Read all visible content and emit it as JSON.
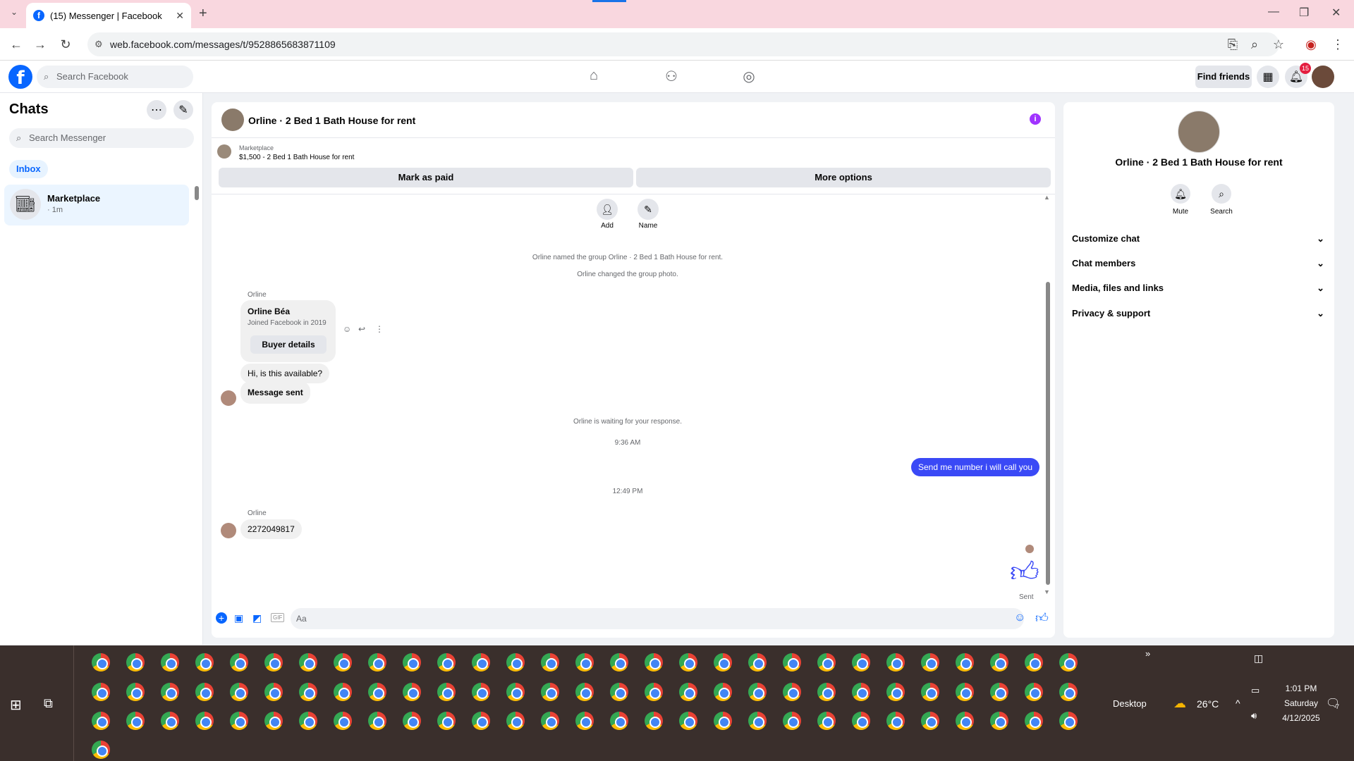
{
  "browser": {
    "tab_title": "(15) Messenger | Facebook",
    "url": "web.facebook.com/messages/t/9528865683871109"
  },
  "fb_header": {
    "search_placeholder": "Search Facebook",
    "find_friends": "Find friends",
    "notification_count": "15"
  },
  "sidebar": {
    "title": "Chats",
    "search_placeholder": "Search Messenger",
    "filter_inbox": "Inbox",
    "chats": [
      {
        "name": "Marketplace",
        "time": "· 1m"
      }
    ]
  },
  "chat": {
    "title": "Orline · 2 Bed 1 Bath House for rent",
    "listing_source": "Marketplace",
    "listing_summary": "$1,500 - 2 Bed 1 Bath House for rent",
    "mark_paid": "Mark as paid",
    "more_options": "More options",
    "add_label": "Add",
    "name_label": "Name",
    "sys_named": "Orline named the group Orline · 2 Bed 1 Bath House for rent.",
    "sys_photo": "Orline changed the group photo.",
    "sender_label_1": "Orline",
    "buyer_name": "Orline Béa",
    "buyer_joined": "Joined Facebook in 2019",
    "buyer_details": "Buyer details",
    "msg_available": "Hi, is this available?",
    "msg_sent_card": "Message sent",
    "sys_waiting": "Orline is waiting for your response.",
    "time_1": "9:36 AM",
    "my_msg": "Send me number i will call you",
    "time_2": "12:49 PM",
    "sender_label_2": "Orline",
    "msg_number": "2272049817",
    "status_sent": "Sent",
    "composer_placeholder": "Aa"
  },
  "info_panel": {
    "title": "Orline · 2 Bed 1 Bath House for rent",
    "mute": "Mute",
    "search": "Search",
    "sections": [
      "Customize chat",
      "Chat members",
      "Media, files and links",
      "Privacy & support"
    ]
  },
  "taskbar": {
    "desktop_label": "Desktop",
    "weather": "26°C",
    "time": "1:01 PM",
    "day": "Saturday",
    "date": "4/12/2025",
    "notif_count": "7"
  },
  "colors": {
    "accent": "#0866ff",
    "my_bubble": "#3a49f6",
    "info_icon": "#a033ff",
    "tabbar": "#f9d7df"
  }
}
